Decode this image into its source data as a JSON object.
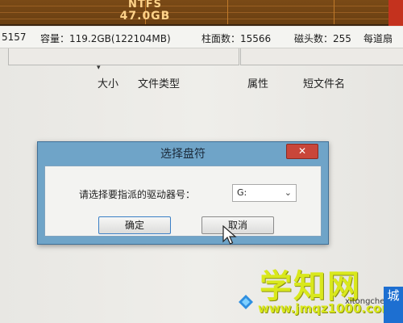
{
  "partition": {
    "filesystem": "NTFS",
    "size": "47.0GB"
  },
  "disk_info": {
    "id_fragment": "5157",
    "capacity": "容量：119.2GB(122104MB)",
    "cylinders": "柱面数：15566",
    "heads": "磁头数：255",
    "sectors_fragment": "每道扇"
  },
  "columns": {
    "size": "大小",
    "file_type": "文件类型",
    "attributes": "属性",
    "short_name": "短文件名"
  },
  "dialog": {
    "title": "选择盘符",
    "close_symbol": "✕",
    "prompt": "请选择要指派的驱动器号：",
    "selected_drive": "G:",
    "ok_label": "确定",
    "cancel_label": "取消"
  },
  "watermark": {
    "brand": "学知网",
    "url": "www.jmqz1000.com",
    "site_small": "xitongcheng.com",
    "badge": "城"
  },
  "colors": {
    "partition": "#6a3f12",
    "dialog_frame": "#6fa4c8",
    "close_button": "#c9463a",
    "watermark": "#d9e81c"
  }
}
